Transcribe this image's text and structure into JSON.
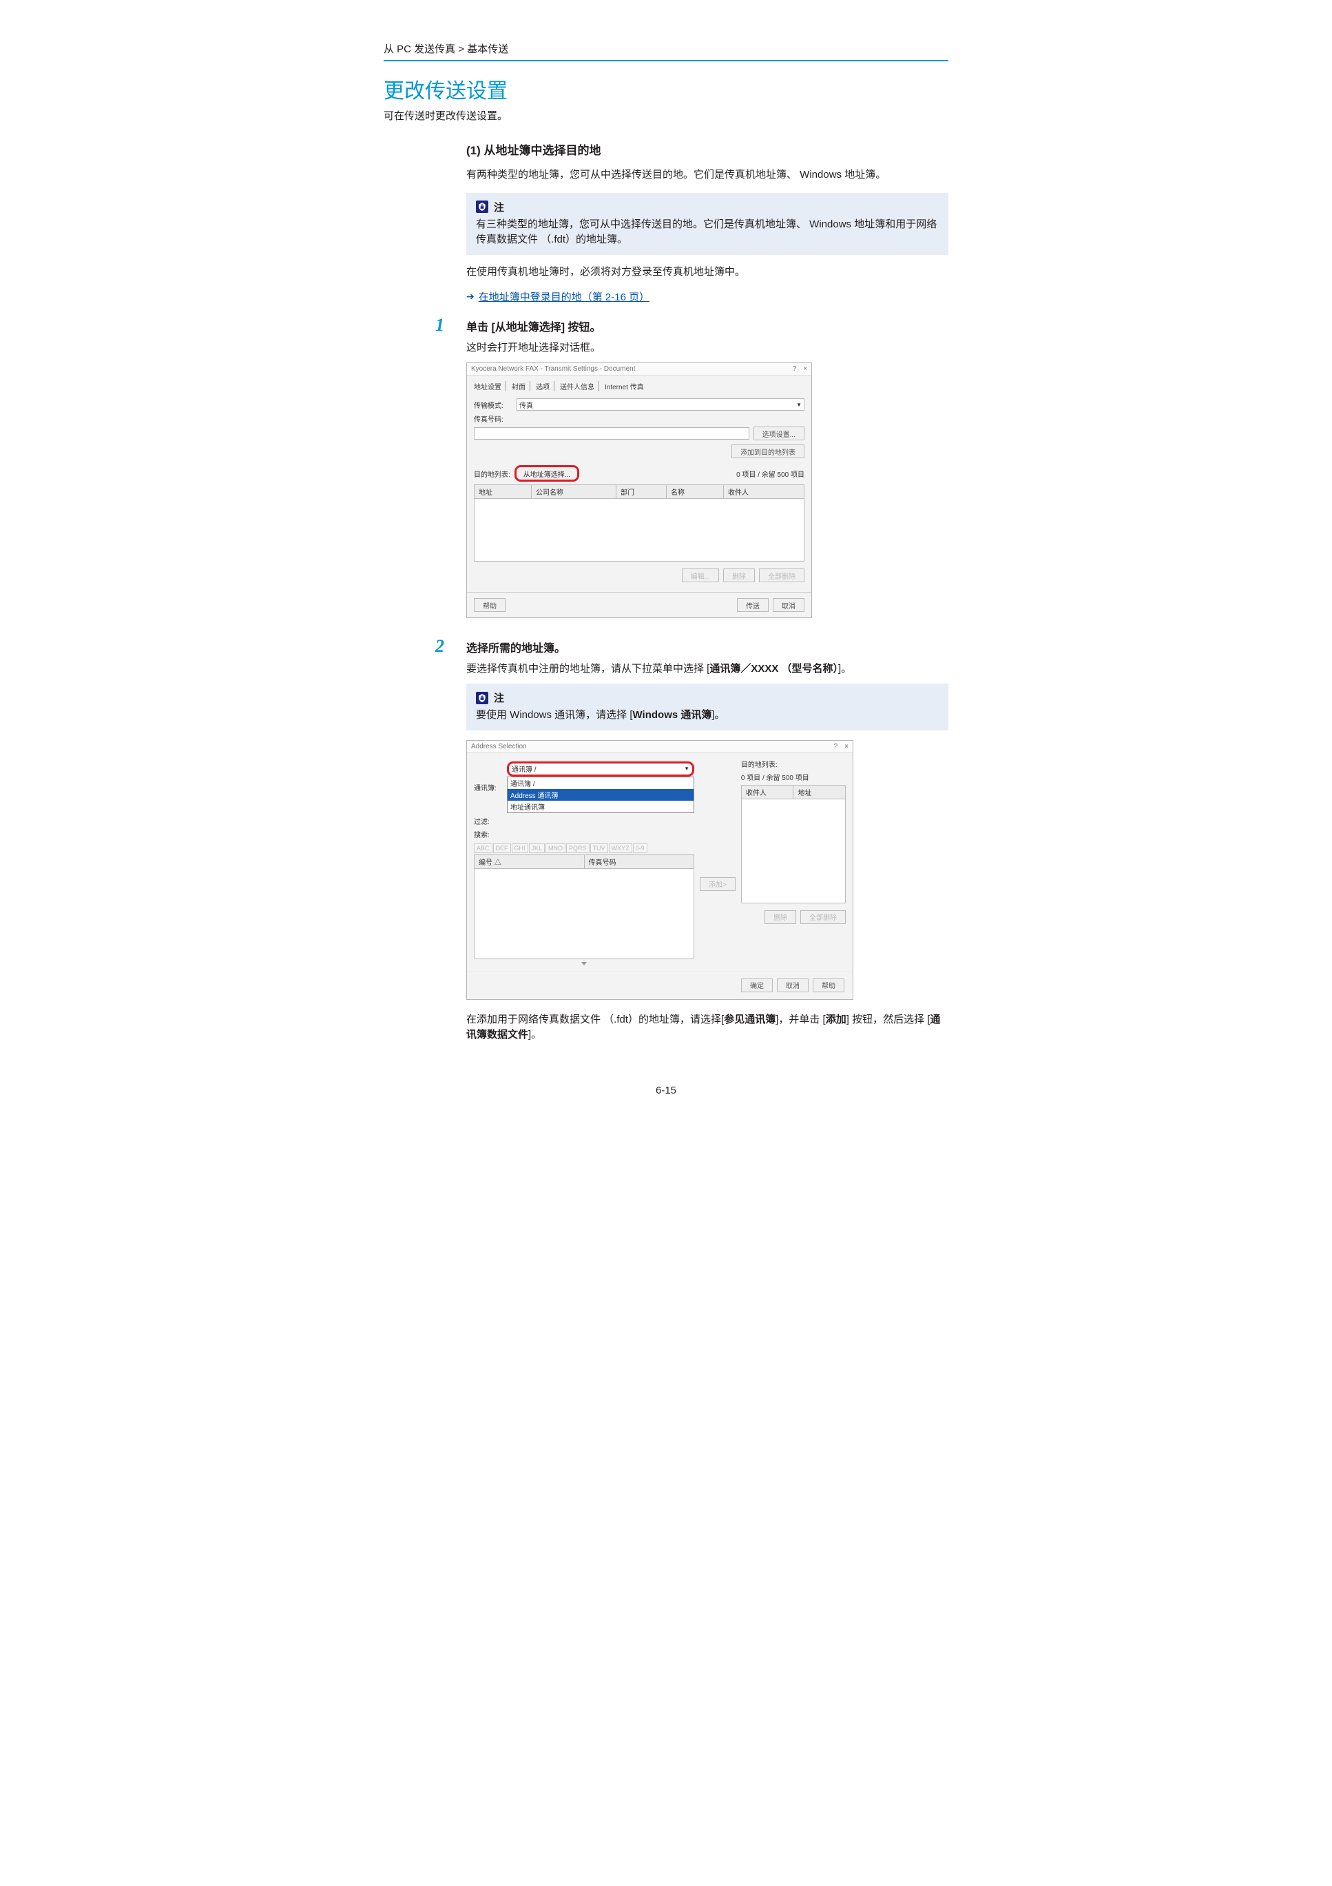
{
  "breadcrumb": "从 PC 发送传真 > 基本传送",
  "title": "更改传送设置",
  "subtitle": "可在传送时更改传送设置。",
  "section1": {
    "heading": "(1) 从地址簿中选择目的地",
    "intro": "有两种类型的地址簿，您可从中选择传送目的地。它们是传真机地址簿、 Windows 地址簿。",
    "note_label": "注",
    "note_body": "有三种类型的地址簿，您可从中选择传送目的地。它们是传真机地址簿、 Windows 地址簿和用于网络传真数据文件 （.fdt）的地址簿。",
    "after_note": "在使用传真机地址簿时，必须将对方登录至传真机地址簿中。",
    "link_text": "在地址簿中登录目的地（第 2-16 页）"
  },
  "step1": {
    "number": "1",
    "title": "单击 [从地址簿选择] 按钮。",
    "body": "这时会打开地址选择对话框。"
  },
  "dialog1": {
    "window_title": "Kyocera Network FAX - Transmit Settings - Document",
    "help": "?",
    "close": "×",
    "tabs": [
      "地址设置",
      "封面",
      "选项",
      "送件人信息",
      "Internet 传真"
    ],
    "label_mode": "传输模式:",
    "mode_value": "传真",
    "label_faxnum": "传真号码:",
    "btn_options": "选项设置...",
    "btn_add_dest": "添加到目的地列表",
    "label_destlist": "目的地列表:",
    "btn_from_addr": "从地址簿选择...",
    "count_text": "0 项目 / 余留 500 项目",
    "cols": [
      "地址",
      "公司名称",
      "部门",
      "名称",
      "收件人"
    ],
    "btn_edit": "编辑...",
    "btn_delete": "删除",
    "btn_delete_all": "全部删除",
    "btn_help": "帮助",
    "btn_send": "传送",
    "btn_cancel": "取消"
  },
  "step2": {
    "number": "2",
    "title": "选择所需的地址簿。",
    "body_prefix": "要选择传真机中注册的地址簿，请从下拉菜单中选择 [",
    "body_bold": "通讯簿／XXXX （型号名称）",
    "body_suffix": "]。",
    "note_label": "注",
    "note_body_prefix": "要使用 Windows 通讯簿，请选择 [",
    "note_body_bold": "Windows 通讯簿",
    "note_body_suffix": "]。"
  },
  "dialog2": {
    "window_title": "Address Selection",
    "help": "?",
    "close": "×",
    "label_addrbook": "通讯簿:",
    "sel_value": "通讯簿 /",
    "options": [
      "通讯簿 /",
      "Address 通讯簿",
      "地址通讯簿"
    ],
    "label_filter": "过滤:",
    "label_search": "搜索:",
    "letter_tabs": [
      "ABC",
      "DEF",
      "GHI",
      "JKL",
      "MNO",
      "PQRS",
      "TUV",
      "WXYZ",
      "0-9"
    ],
    "left_cols": [
      "编号 △",
      "传真号码"
    ],
    "btn_add": "添加>",
    "right_label": "目的地列表:",
    "right_count": "0 项目 / 余留 500 项目",
    "right_cols": [
      "收件人",
      "地址"
    ],
    "btn_delete": "删除",
    "btn_delete_all": "全部删除",
    "btn_ok": "确定",
    "btn_cancel": "取消",
    "btn_help": "帮助"
  },
  "step2_trailing": {
    "part1": "在添加用于网络传真数据文件 （.fdt）的地址簿，请选择[",
    "bold1": "参见通讯簿",
    "part2": "]，并单击 [",
    "bold2": "添加",
    "part3": "] 按钮，然后选择 [",
    "bold3": "通讯簿数据文件",
    "part4": "]。"
  },
  "page_number": "6-15"
}
